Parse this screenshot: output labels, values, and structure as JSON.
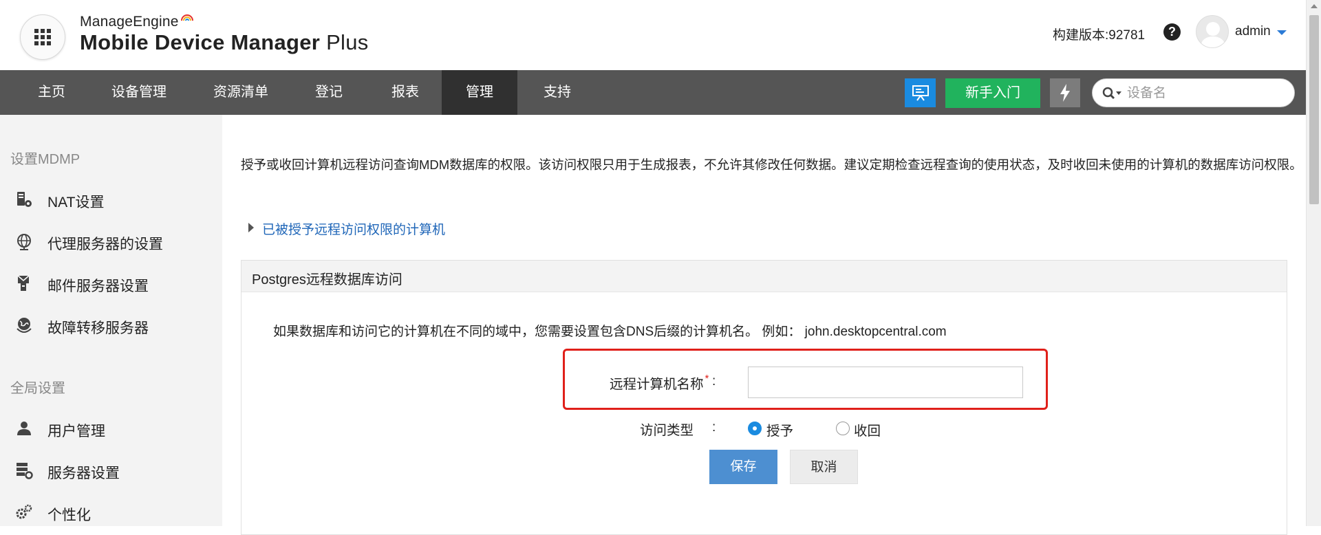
{
  "brand": {
    "company": "ManageEngine",
    "product_bold": "Mobile Device Manager",
    "product_suffix": "Plus"
  },
  "header": {
    "build_version": "构建版本:92781",
    "help_symbol": "?",
    "user": "admin"
  },
  "nav": {
    "items": [
      "主页",
      "设备管理",
      "资源清单",
      "登记",
      "报表",
      "管理",
      "支持"
    ],
    "active": "管理",
    "getting_started": "新手入门",
    "search_placeholder": "设备名"
  },
  "sidebar": {
    "section1": "设置MDMP",
    "section1_items": [
      {
        "label": "NAT设置",
        "icon": "nat-server-icon"
      },
      {
        "label": "代理服务器的设置",
        "icon": "globe-icon"
      },
      {
        "label": "邮件服务器设置",
        "icon": "mail-server-icon"
      },
      {
        "label": "故障转移服务器",
        "icon": "failover-globe-icon"
      }
    ],
    "section2": "全局设置",
    "section2_items": [
      {
        "label": "用户管理",
        "icon": "user-icon"
      },
      {
        "label": "服务器设置",
        "icon": "server-settings-icon"
      },
      {
        "label": "个性化",
        "icon": "gears-icon"
      }
    ]
  },
  "main": {
    "description": "授予或收回计算机远程访问查询MDM数据库的权限。该访问权限只用于生成报表，不允许其修改任何数据。建议定期检查远程查询的使用状态，及时收回未使用的计算机的数据库访问权限。",
    "granted_link": "已被授予远程访问权限的计算机",
    "panel_title": "Postgres远程数据库访问",
    "panel_note": "如果数据库和访问它的计算机在不同的域中，您需要设置包含DNS后缀的计算机名。 例如： john.desktopcentral.com",
    "form": {
      "computer_name_label": "远程计算机名称",
      "required_mark": "*",
      "colon": ":",
      "computer_name_value": "",
      "access_type_label": "访问类型",
      "access_options": [
        "授予",
        "收回"
      ],
      "access_selected": "授予",
      "save": "保存",
      "cancel": "取消"
    }
  },
  "colors": {
    "nav_bg": "#555555",
    "nav_active": "#303030",
    "accent_blue": "#1a8be0",
    "start_green": "#21b35d",
    "link_blue": "#1f66b8",
    "highlight_red": "#e0201a",
    "save_blue": "#4d8fd1"
  }
}
